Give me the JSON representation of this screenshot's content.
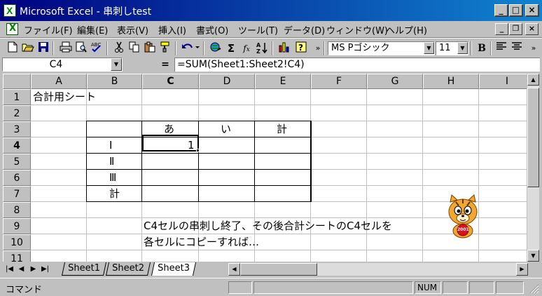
{
  "window": {
    "title": "Microsoft Excel - 串刺しtest",
    "minimize": "_",
    "maximize": "□",
    "close": "×"
  },
  "menubar": {
    "items": [
      "ファイル(F)",
      "編集(E)",
      "表示(V)",
      "挿入(I)",
      "書式(O)",
      "ツール(T)",
      "データ(D)",
      "ウィンドウ(W)",
      "ヘルプ(H)"
    ],
    "doc_minimize": "_",
    "doc_restore": "❐",
    "doc_close": "×"
  },
  "toolbar": {
    "font_name": "MS Pゴシック",
    "font_size": "11",
    "bold": "B",
    "icons": [
      "new-icon",
      "open-icon",
      "save-icon",
      "print-icon",
      "print-preview-icon",
      "spelling-icon",
      "cut-icon",
      "copy-icon",
      "paste-icon",
      "format-painter-icon",
      "undo-icon",
      "hyperlink-icon",
      "autosum-icon",
      "function-icon",
      "sort-ascending-icon",
      "chart-wizard-icon",
      "help-icon",
      "more-icon",
      "align-left-icon",
      "align-center-icon"
    ]
  },
  "formulabar": {
    "name_box": "C4",
    "equals": "=",
    "formula": "=SUM(Sheet1:Sheet2!C4)"
  },
  "grid": {
    "columns": [
      "A",
      "B",
      "C",
      "D",
      "E",
      "F",
      "G",
      "H",
      "I"
    ],
    "rows": [
      "1",
      "2",
      "3",
      "4",
      "5",
      "6",
      "7",
      "8",
      "9",
      "10",
      "11"
    ],
    "active_cell": "C4",
    "cells": {
      "A1": "合計用シート",
      "C3": "あ",
      "D3": "い",
      "E3": "計",
      "B4": "Ⅰ",
      "C4": "1",
      "B5": "Ⅱ",
      "B6": "Ⅲ",
      "B7": "計",
      "C9": "C4セルの串刺し終了、その後合計シートのC4セルを",
      "C10": "各セルにコピーすれば…"
    }
  },
  "sheets": {
    "tabs": [
      "Sheet1",
      "Sheet2",
      "Sheet3"
    ],
    "active": "Sheet3"
  },
  "statusbar": {
    "mode": "コマンド",
    "num": "NUM"
  },
  "assistant": {
    "badge": "2001"
  }
}
